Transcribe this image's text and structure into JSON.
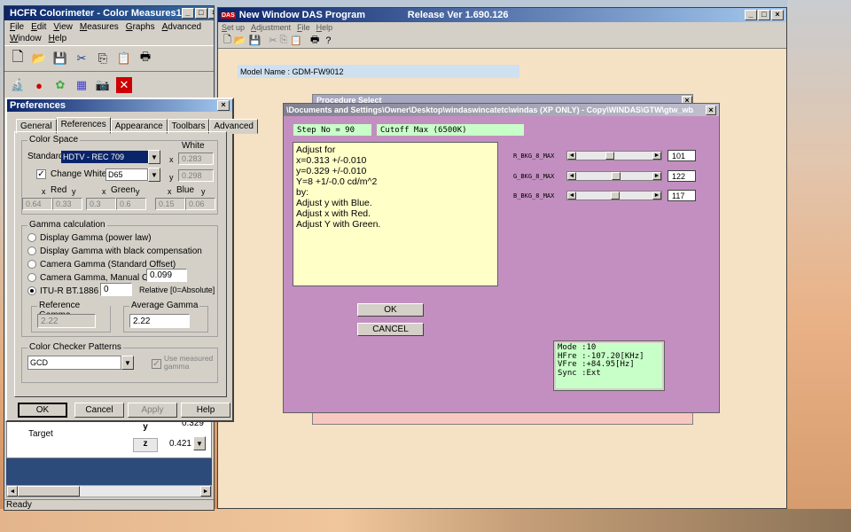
{
  "hcfr": {
    "title": "HCFR Colorimeter - Color Measures1",
    "menu1": [
      "File",
      "Edit",
      "View",
      "Measures",
      "Graphs",
      "Advanced"
    ],
    "menu2": [
      "Window",
      "Help"
    ],
    "target_label": "Target",
    "y_label": "y",
    "z_label": "z",
    "y_value": "0.329",
    "z_value": "0.421",
    "status": "Ready"
  },
  "prefs": {
    "title": "Preferences",
    "tabs": [
      "General",
      "References",
      "Appearance",
      "Toolbars",
      "Advanced"
    ],
    "active_tab": "References",
    "colorspace": {
      "group": "Color Space",
      "standard_label": "Standard:",
      "standard_value": "HDTV - REC 709",
      "change_white_label": "Change White",
      "white_value": "D65",
      "white_group": "White",
      "white_x_label": "x",
      "white_x": "0.283",
      "white_y_label": "y",
      "white_y": "0.298",
      "red_label": "Red",
      "green_label": "Green",
      "blue_label": "Blue",
      "x_label": "x",
      "y_label": "y",
      "red_x": "0.64",
      "red_y": "0.33",
      "green_x": "0.3",
      "green_y": "0.6",
      "blue_x": "0.15",
      "blue_y": "0.06"
    },
    "gamma": {
      "group": "Gamma calculation",
      "opt1": "Display Gamma (power law)",
      "opt2": "Display Gamma with black compensation",
      "opt3": "Camera Gamma (Standard Offset)",
      "opt4": "Camera Gamma, Manual Offset :",
      "opt4_value": "0.099",
      "opt5": "ITU-R BT.1886",
      "opt5_value": "0",
      "relative_label": "Relative [0=Absolute]",
      "ref_group": "Reference Gamma",
      "ref_value": "2.22",
      "avg_group": "Average Gamma",
      "avg_value": "2.22"
    },
    "checker": {
      "group": "Color Checker Patterns",
      "value": "GCD",
      "use_measured": "Use measured gamma"
    },
    "buttons": {
      "ok": "OK",
      "cancel": "Cancel",
      "apply": "Apply",
      "help": "Help"
    }
  },
  "das": {
    "title": "New Window DAS Program",
    "release": "Release Ver 1.690.126",
    "menu": [
      "Set up",
      "Adjustment",
      "File",
      "Help"
    ],
    "model_label": "Model Name : GDM-FW9012",
    "procedure_title": "Procedure Select"
  },
  "adjust": {
    "title": "\\Documents and Settings\\Owner\\Desktop\\windaswincatetc\\windas (XP ONLY) - Copy\\WINDAS\\GTW\\gtw_wb...",
    "step_label": "Step No =  90",
    "cutoff_label": "Cutoff Max (6500K)",
    "instructions": [
      "Adjust for",
      "x=0.313 +/-0.010",
      "y=0.329 +/-0.010",
      "Y=8 +1/-0.0 cd/m^2",
      "by:",
      "Adjust y with Blue.",
      "Adjust x with Red.",
      "Adjust Y with Green."
    ],
    "sliders": [
      {
        "label": "R_BKG_8_MAX",
        "value": "101",
        "level": 0.44
      },
      {
        "label": "G_BKG_8_MAX",
        "value": "122",
        "level": 0.53
      },
      {
        "label": "B_BKG_8_MAX",
        "value": "117",
        "level": 0.51
      }
    ],
    "ok": "OK",
    "cancel": "CANCEL",
    "mode_lines": [
      "Mode :10",
      "HFre :-107.20[KHz]",
      "VFre :+84.95[Hz]",
      "Sync :Ext"
    ]
  },
  "colors": {
    "title_blue": "#0a246a",
    "adjust_bg": "#c38fc0",
    "das_bg": "#f5e2c4",
    "note_bg": "#ffffc8",
    "step_bg": "#c8ffc8"
  }
}
